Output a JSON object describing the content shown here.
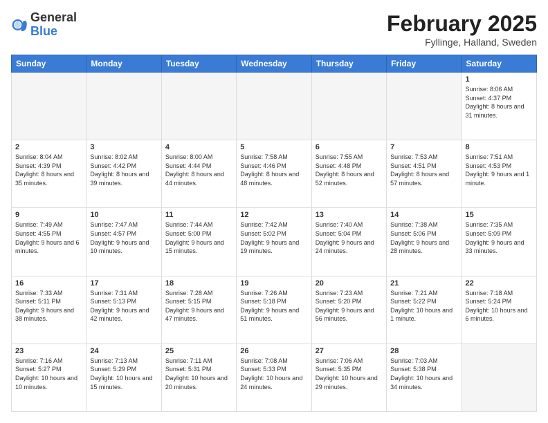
{
  "header": {
    "logo_general": "General",
    "logo_blue": "Blue",
    "month_title": "February 2025",
    "subtitle": "Fyllinge, Halland, Sweden"
  },
  "days_of_week": [
    "Sunday",
    "Monday",
    "Tuesday",
    "Wednesday",
    "Thursday",
    "Friday",
    "Saturday"
  ],
  "weeks": [
    [
      {
        "day": "",
        "info": ""
      },
      {
        "day": "",
        "info": ""
      },
      {
        "day": "",
        "info": ""
      },
      {
        "day": "",
        "info": ""
      },
      {
        "day": "",
        "info": ""
      },
      {
        "day": "",
        "info": ""
      },
      {
        "day": "1",
        "info": "Sunrise: 8:06 AM\nSunset: 4:37 PM\nDaylight: 8 hours and 31 minutes."
      }
    ],
    [
      {
        "day": "2",
        "info": "Sunrise: 8:04 AM\nSunset: 4:39 PM\nDaylight: 8 hours and 35 minutes."
      },
      {
        "day": "3",
        "info": "Sunrise: 8:02 AM\nSunset: 4:42 PM\nDaylight: 8 hours and 39 minutes."
      },
      {
        "day": "4",
        "info": "Sunrise: 8:00 AM\nSunset: 4:44 PM\nDaylight: 8 hours and 44 minutes."
      },
      {
        "day": "5",
        "info": "Sunrise: 7:58 AM\nSunset: 4:46 PM\nDaylight: 8 hours and 48 minutes."
      },
      {
        "day": "6",
        "info": "Sunrise: 7:55 AM\nSunset: 4:48 PM\nDaylight: 8 hours and 52 minutes."
      },
      {
        "day": "7",
        "info": "Sunrise: 7:53 AM\nSunset: 4:51 PM\nDaylight: 8 hours and 57 minutes."
      },
      {
        "day": "8",
        "info": "Sunrise: 7:51 AM\nSunset: 4:53 PM\nDaylight: 9 hours and 1 minute."
      }
    ],
    [
      {
        "day": "9",
        "info": "Sunrise: 7:49 AM\nSunset: 4:55 PM\nDaylight: 9 hours and 6 minutes."
      },
      {
        "day": "10",
        "info": "Sunrise: 7:47 AM\nSunset: 4:57 PM\nDaylight: 9 hours and 10 minutes."
      },
      {
        "day": "11",
        "info": "Sunrise: 7:44 AM\nSunset: 5:00 PM\nDaylight: 9 hours and 15 minutes."
      },
      {
        "day": "12",
        "info": "Sunrise: 7:42 AM\nSunset: 5:02 PM\nDaylight: 9 hours and 19 minutes."
      },
      {
        "day": "13",
        "info": "Sunrise: 7:40 AM\nSunset: 5:04 PM\nDaylight: 9 hours and 24 minutes."
      },
      {
        "day": "14",
        "info": "Sunrise: 7:38 AM\nSunset: 5:06 PM\nDaylight: 9 hours and 28 minutes."
      },
      {
        "day": "15",
        "info": "Sunrise: 7:35 AM\nSunset: 5:09 PM\nDaylight: 9 hours and 33 minutes."
      }
    ],
    [
      {
        "day": "16",
        "info": "Sunrise: 7:33 AM\nSunset: 5:11 PM\nDaylight: 9 hours and 38 minutes."
      },
      {
        "day": "17",
        "info": "Sunrise: 7:31 AM\nSunset: 5:13 PM\nDaylight: 9 hours and 42 minutes."
      },
      {
        "day": "18",
        "info": "Sunrise: 7:28 AM\nSunset: 5:15 PM\nDaylight: 9 hours and 47 minutes."
      },
      {
        "day": "19",
        "info": "Sunrise: 7:26 AM\nSunset: 5:18 PM\nDaylight: 9 hours and 51 minutes."
      },
      {
        "day": "20",
        "info": "Sunrise: 7:23 AM\nSunset: 5:20 PM\nDaylight: 9 hours and 56 minutes."
      },
      {
        "day": "21",
        "info": "Sunrise: 7:21 AM\nSunset: 5:22 PM\nDaylight: 10 hours and 1 minute."
      },
      {
        "day": "22",
        "info": "Sunrise: 7:18 AM\nSunset: 5:24 PM\nDaylight: 10 hours and 6 minutes."
      }
    ],
    [
      {
        "day": "23",
        "info": "Sunrise: 7:16 AM\nSunset: 5:27 PM\nDaylight: 10 hours and 10 minutes."
      },
      {
        "day": "24",
        "info": "Sunrise: 7:13 AM\nSunset: 5:29 PM\nDaylight: 10 hours and 15 minutes."
      },
      {
        "day": "25",
        "info": "Sunrise: 7:11 AM\nSunset: 5:31 PM\nDaylight: 10 hours and 20 minutes."
      },
      {
        "day": "26",
        "info": "Sunrise: 7:08 AM\nSunset: 5:33 PM\nDaylight: 10 hours and 24 minutes."
      },
      {
        "day": "27",
        "info": "Sunrise: 7:06 AM\nSunset: 5:35 PM\nDaylight: 10 hours and 29 minutes."
      },
      {
        "day": "28",
        "info": "Sunrise: 7:03 AM\nSunset: 5:38 PM\nDaylight: 10 hours and 34 minutes."
      },
      {
        "day": "",
        "info": ""
      }
    ]
  ]
}
